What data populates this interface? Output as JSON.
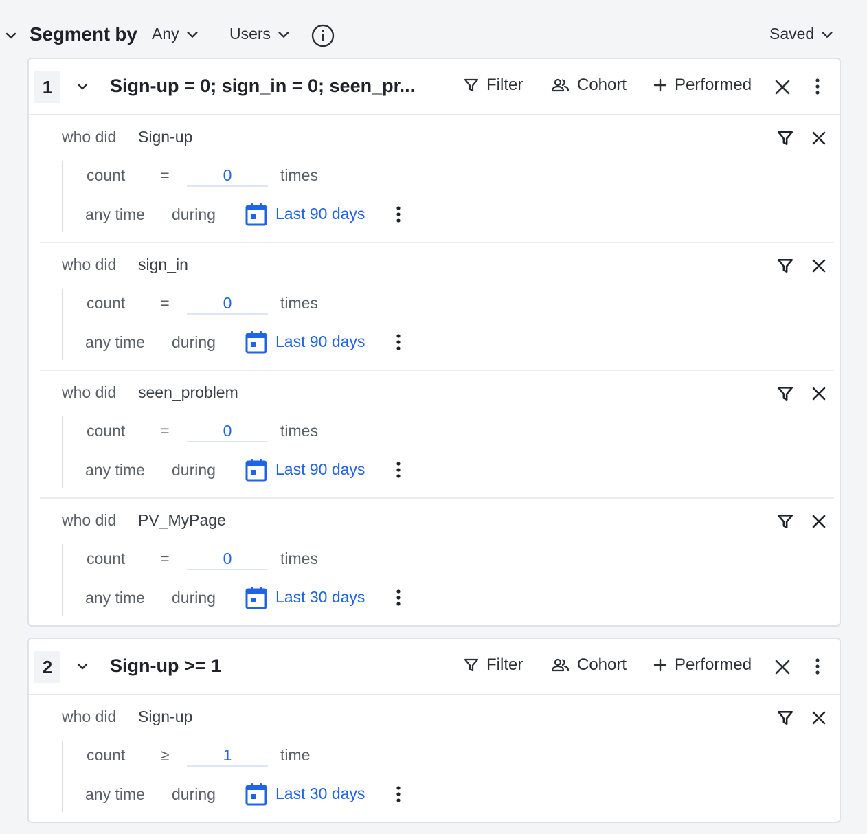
{
  "header": {
    "title": "Segment by",
    "match_mode": "Any",
    "entity": "Users",
    "saved_label": "Saved"
  },
  "segments": [
    {
      "number": "1",
      "title": "Sign-up = 0; sign_in = 0; seen_pr...",
      "actions": {
        "filter": "Filter",
        "cohort": "Cohort",
        "performed": "Performed"
      },
      "conditions": [
        {
          "who": "who did",
          "event": "Sign-up",
          "count_label": "count",
          "operator": "=",
          "value": "0",
          "unit": "times",
          "time_label": "any time",
          "during": "during",
          "range": "Last 90 days"
        },
        {
          "who": "who did",
          "event": "sign_in",
          "count_label": "count",
          "operator": "=",
          "value": "0",
          "unit": "times",
          "time_label": "any time",
          "during": "during",
          "range": "Last 90 days"
        },
        {
          "who": "who did",
          "event": "seen_problem",
          "count_label": "count",
          "operator": "=",
          "value": "0",
          "unit": "times",
          "time_label": "any time",
          "during": "during",
          "range": "Last 90 days"
        },
        {
          "who": "who did",
          "event": "PV_MyPage",
          "count_label": "count",
          "operator": "=",
          "value": "0",
          "unit": "times",
          "time_label": "any time",
          "during": "during",
          "range": "Last 30 days"
        }
      ]
    },
    {
      "number": "2",
      "title": "Sign-up >= 1",
      "actions": {
        "filter": "Filter",
        "cohort": "Cohort",
        "performed": "Performed"
      },
      "conditions": [
        {
          "who": "who did",
          "event": "Sign-up",
          "count_label": "count",
          "operator": "≥",
          "value": "1",
          "unit": "time",
          "time_label": "any time",
          "during": "during",
          "range": "Last 30 days"
        }
      ]
    }
  ],
  "colors": {
    "accent": "#1f63e6",
    "background": "#f4f5f7",
    "card": "#ffffff"
  },
  "icons": [
    "chevron-down-icon",
    "info-icon",
    "filter-icon",
    "cohort-icon",
    "plus-icon",
    "close-icon",
    "more-vertical-icon",
    "calendar-icon"
  ]
}
